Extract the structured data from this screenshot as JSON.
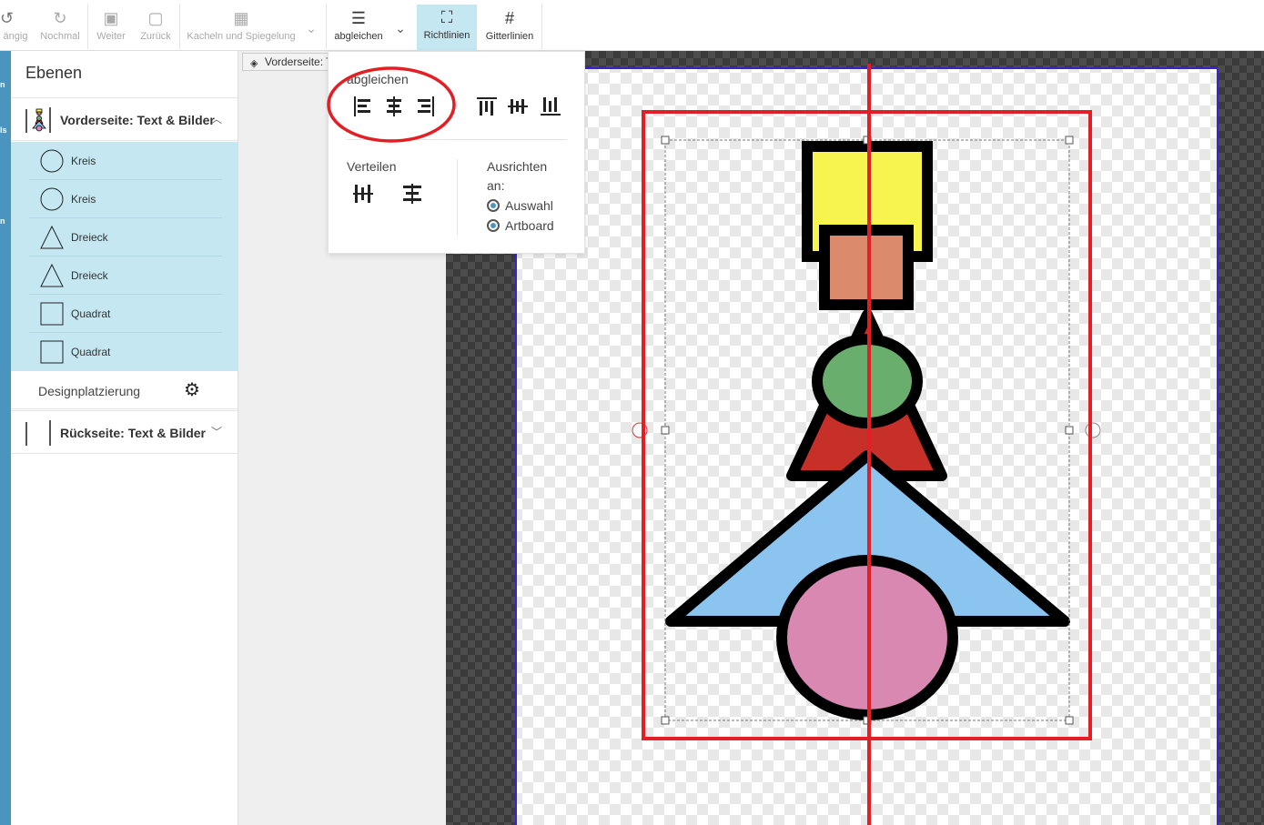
{
  "toolbar": {
    "undo_label": "ängig",
    "redo_label": "Nochmal",
    "forward_label": "Weiter",
    "back_label": "Zurück",
    "tiles_label": "Kacheln und Spiegelung",
    "align_label": "abgleichen",
    "guides_label": "Richtlinien",
    "grid_label": "Gitterlinien"
  },
  "rail": {
    "label_1": "n",
    "label_2": "ls",
    "label_3": "n"
  },
  "layers": {
    "title": "Ebenen",
    "front_group": "Vorderseite: Text & Bilder",
    "items": [
      {
        "label": "Kreis",
        "icon": "circle-icon"
      },
      {
        "label": "Kreis",
        "icon": "circle-icon"
      },
      {
        "label": "Dreieck",
        "icon": "triangle-icon"
      },
      {
        "label": "Dreieck",
        "icon": "triangle-icon"
      },
      {
        "label": "Quadrat",
        "icon": "square-icon"
      },
      {
        "label": "Quadrat",
        "icon": "square-icon"
      }
    ],
    "design_placement": "Designplatzierung",
    "back_group": "Rückseite: Text & Bilder"
  },
  "breadcrumb": "Vorderseite: T",
  "align_panel": {
    "title": "abgleichen",
    "distribute_label": "Verteilen",
    "align_to_label_1": "Ausrichten",
    "align_to_label_2": "an:",
    "option_selection": "Auswahl",
    "option_artboard": "Artboard"
  },
  "colors": {
    "accent": "#4a95c0",
    "active_bg": "#c5e7f1",
    "annotation_red": "#e31e24",
    "yellow": "#f7f44f",
    "salmon": "#dc8a6c",
    "green": "#6aae6e",
    "red": "#c73028",
    "blue": "#8ac4ef",
    "pink": "#d888b1"
  }
}
